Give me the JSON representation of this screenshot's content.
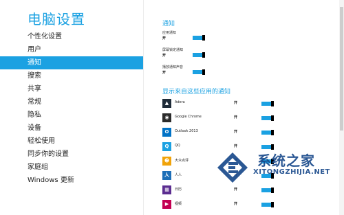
{
  "left": {
    "title": "电脑设置",
    "nav_items": [
      {
        "label": "个性化设置"
      },
      {
        "label": "用户"
      },
      {
        "label": "通知"
      },
      {
        "label": "搜索"
      },
      {
        "label": "共享"
      },
      {
        "label": "常规"
      },
      {
        "label": "隐私"
      },
      {
        "label": "设备"
      },
      {
        "label": "轻松使用"
      },
      {
        "label": "同步你的设置"
      },
      {
        "label": "家庭组"
      },
      {
        "label": "Windows 更新"
      }
    ],
    "selected_index": 2
  },
  "right": {
    "section1_title": "通知",
    "settings": [
      {
        "label": "应用通知",
        "value": "开"
      },
      {
        "label": "屏幕锁定通知",
        "value": "开"
      },
      {
        "label": "播放通知声音",
        "value": "开"
      }
    ],
    "section2_title": "显示来自这些应用的通知",
    "apps": [
      {
        "name": "Adera",
        "state": "开",
        "icon": "adera-icon",
        "color": "#1e2b38",
        "glyph": "▲"
      },
      {
        "name": "Google Chrome",
        "state": "开",
        "icon": "chrome-icon",
        "color": "#2b2b2b",
        "glyph": "◉"
      },
      {
        "name": "Outlook 2013",
        "state": "开",
        "icon": "outlook-icon",
        "color": "#0072c6",
        "glyph": "O"
      },
      {
        "name": "QQ",
        "state": "开",
        "icon": "qq-icon",
        "color": "#1ba1e2",
        "glyph": "Q"
      },
      {
        "name": "大众点评",
        "state": "开",
        "icon": "dianping-icon",
        "color": "#f0a30a",
        "glyph": "☻"
      },
      {
        "name": "人人",
        "state": "开",
        "icon": "renren-icon",
        "color": "#1e6fb8",
        "glyph": "人"
      },
      {
        "name": "日历",
        "state": "开",
        "icon": "calendar-icon",
        "color": "#5b2d90",
        "glyph": "▦"
      },
      {
        "name": "视频",
        "state": "开",
        "icon": "video-icon",
        "color": "#c30052",
        "glyph": "▶"
      }
    ]
  },
  "watermark": {
    "text": "系统之家",
    "url": "XITONGZHIJIA.NET"
  },
  "colors": {
    "accent": "#1ba1e2",
    "toggle_thumb": "#000000"
  }
}
